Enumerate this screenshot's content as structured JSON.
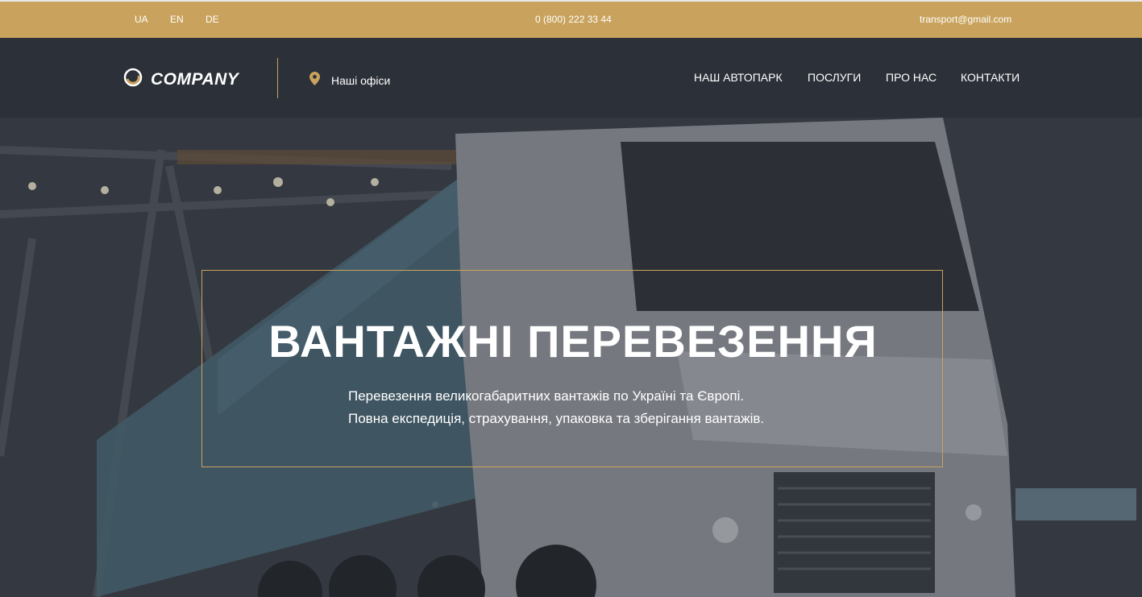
{
  "topbar": {
    "languages": [
      "UA",
      "EN",
      "DE"
    ],
    "phone": "0 (800) 222 33 44",
    "email": "transport@gmail.com"
  },
  "header": {
    "logo_text": "COMPANY",
    "offices_label": "Наші офіси",
    "nav": [
      "НАШ АВТОПАРК",
      "ПОСЛУГИ",
      "ПРО НАС",
      "КОНТАКТИ"
    ]
  },
  "hero": {
    "title": "ВАНТАЖНІ ПЕРЕВЕЗЕННЯ",
    "subtitle_line1": "Перевезення великогабаритних вантажів по Україні та Європі.",
    "subtitle_line2": "Повна експедиція, страхування, упаковка та зберігання вантажів."
  },
  "icons": {
    "logo": "logo-ring-icon",
    "offices": "location-pin-icon"
  },
  "colors": {
    "accent": "#c9a35d",
    "header_bg": "#2c3038",
    "text": "#ffffff"
  }
}
